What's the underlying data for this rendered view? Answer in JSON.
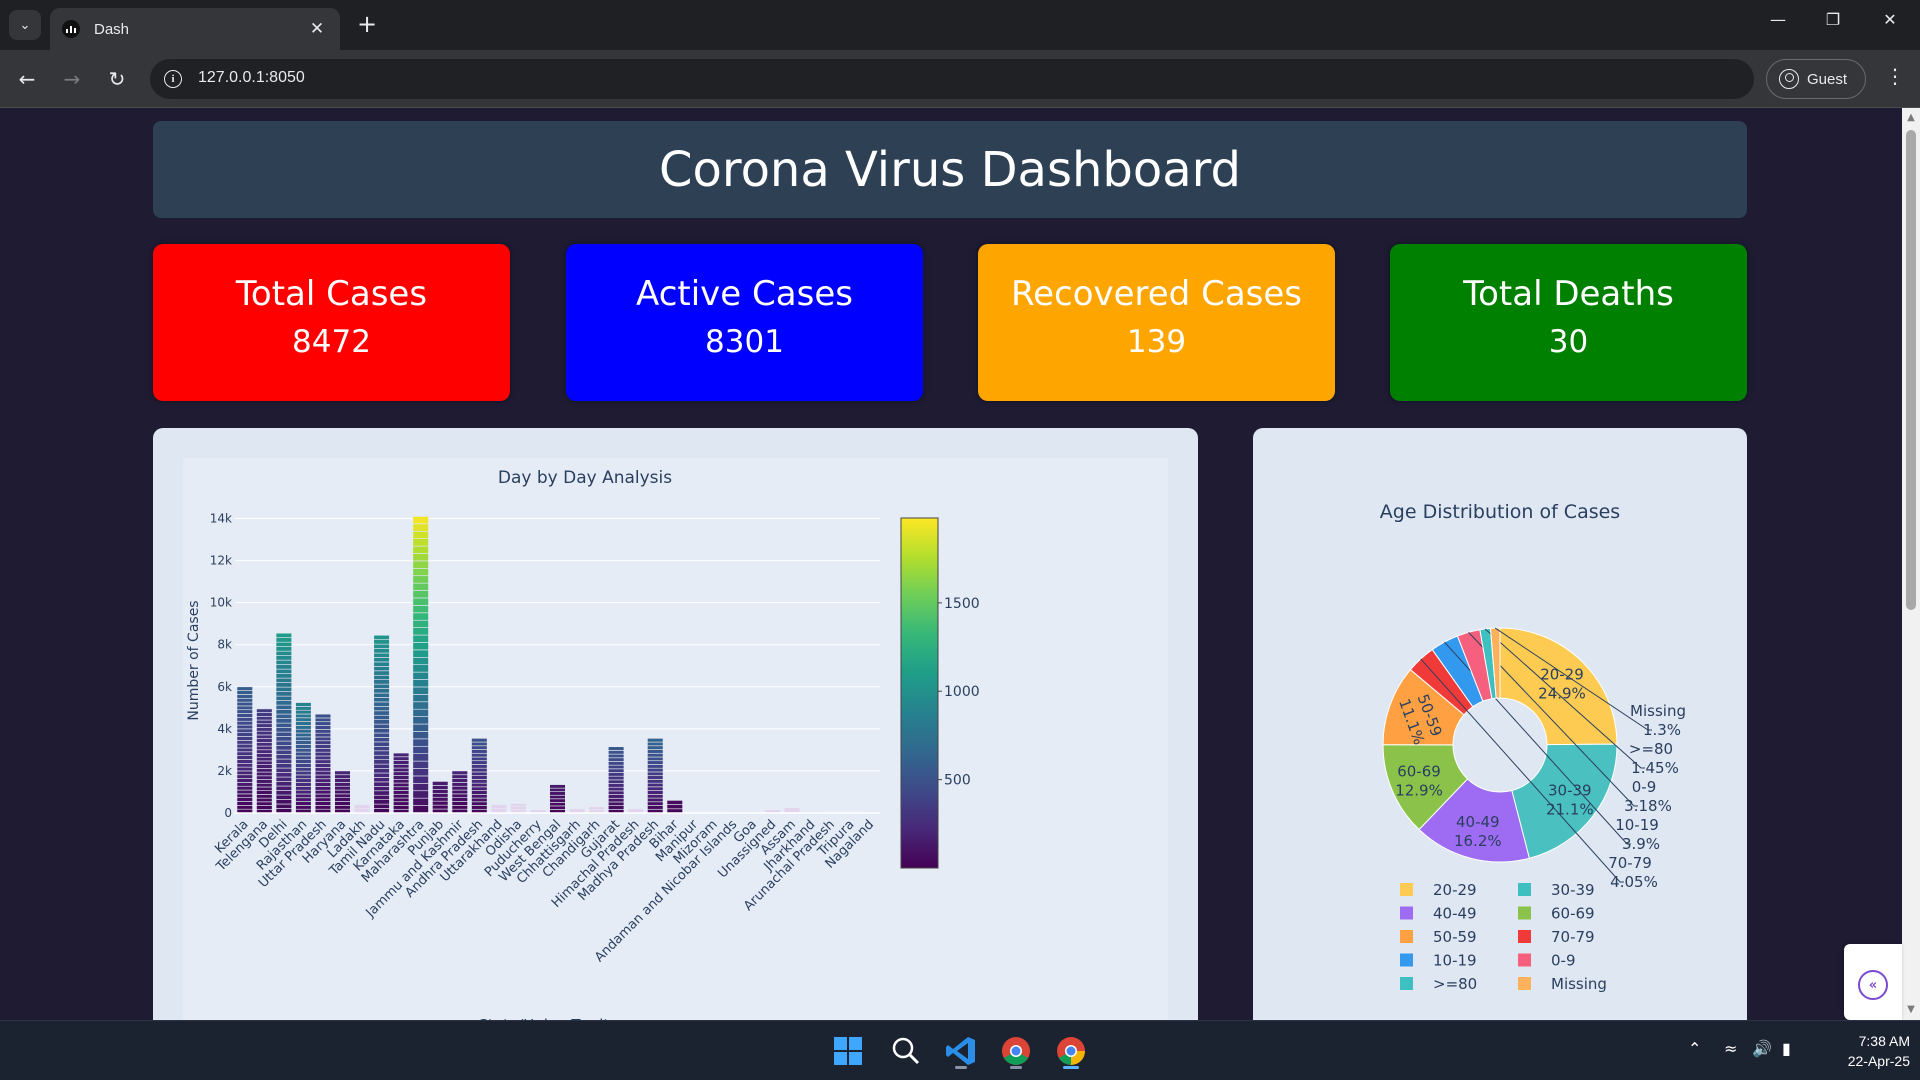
{
  "browser": {
    "tab_title": "Dash",
    "url": "127.0.0.1:8050",
    "profile_label": "Guest"
  },
  "dashboard": {
    "title": "Corona Virus Dashboard",
    "cards": [
      {
        "label": "Total Cases",
        "value": "8472",
        "color": "#ff0000"
      },
      {
        "label": "Active Cases",
        "value": "8301",
        "color": "#0000ff"
      },
      {
        "label": "Recovered Cases",
        "value": "139",
        "color": "#ffa500"
      },
      {
        "label": "Total Deaths",
        "value": "30",
        "color": "#008000"
      }
    ]
  },
  "chart_data": [
    {
      "type": "bar",
      "title": "Day by Day Analysis",
      "xlabel": "State/Union Territory",
      "ylabel": "Number of Cases",
      "ylim": [
        0,
        14500
      ],
      "yticks": [
        0,
        2000,
        4000,
        6000,
        8000,
        10000,
        12000,
        14000
      ],
      "ytick_labels": [
        "0",
        "2k",
        "4k",
        "6k",
        "8k",
        "10k",
        "12k",
        "14k"
      ],
      "colorscale": "Viridis",
      "colorbar": {
        "range": [
          0,
          1980
        ],
        "ticks": [
          500,
          1000,
          1500
        ],
        "tick_labels": [
          "500",
          "1000",
          "1500"
        ]
      },
      "categories": [
        "Kerala",
        "Telengana",
        "Delhi",
        "Rajasthan",
        "Uttar Pradesh",
        "Haryana",
        "Ladakh",
        "Tamil Nadu",
        "Karnataka",
        "Maharashtra",
        "Punjab",
        "Jammu and Kashmir",
        "Andhra Pradesh",
        "Uttarakhand",
        "Odisha",
        "Puducherry",
        "West Bengal",
        "Chhattisgarh",
        "Chandigarh",
        "Gujarat",
        "Himachal Pradesh",
        "Madhya Pradesh",
        "Bihar",
        "Manipur",
        "Mizoram",
        "Andaman and Nicobar Islands",
        "Goa",
        "Unassigned",
        "Assam",
        "Jharkhand",
        "Arunachal Pradesh",
        "Tripura",
        "Nagaland"
      ],
      "values": [
        6000,
        4950,
        8550,
        5250,
        4700,
        2000,
        400,
        8450,
        2850,
        14100,
        1500,
        2000,
        3550,
        400,
        450,
        150,
        1350,
        200,
        300,
        3150,
        200,
        3550,
        600,
        20,
        10,
        50,
        50,
        150,
        250,
        50,
        10,
        10,
        50
      ],
      "peak_colors": [
        600,
        350,
        1100,
        900,
        500,
        200,
        60,
        1050,
        200,
        1980,
        150,
        200,
        500,
        30,
        30,
        20,
        150,
        15,
        30,
        550,
        20,
        650,
        60,
        5,
        5,
        10,
        10,
        20,
        30,
        10,
        5,
        5,
        10
      ]
    },
    {
      "type": "pie",
      "title": "Age Distribution of Cases",
      "labels": [
        "20-29",
        "30-39",
        "40-49",
        "60-69",
        "50-59",
        "70-79",
        "10-19",
        "0-9",
        ">=80",
        "Missing"
      ],
      "values": [
        24.9,
        21.1,
        16.2,
        12.9,
        11.1,
        4.05,
        3.9,
        3.18,
        1.45,
        1.3
      ],
      "percent_labels": [
        "24.9%",
        "21.1%",
        "16.2%",
        "12.9%",
        "11.1%",
        "4.05%",
        "3.9%",
        "3.18%",
        "1.45%",
        "1.3%"
      ],
      "colors": [
        "#fecb52",
        "#4ac0c0",
        "#9e6cf3",
        "#8bc34a",
        "#ffa142",
        "#f03a3a",
        "#3399ee",
        "#f6607e",
        "#3ec0c0",
        "#feb15b"
      ],
      "legend": [
        {
          "label": "20-29",
          "color": "#fecb52"
        },
        {
          "label": "30-39",
          "color": "#3ec0c0"
        },
        {
          "label": "40-49",
          "color": "#9e6cf3"
        },
        {
          "label": "60-69",
          "color": "#8bc34a"
        },
        {
          "label": "50-59",
          "color": "#ffa142"
        },
        {
          "label": "70-79",
          "color": "#f03a3a"
        },
        {
          "label": "10-19",
          "color": "#3399ee"
        },
        {
          "label": "0-9",
          "color": "#f6607e"
        },
        {
          "label": ">=80",
          "color": "#3ec0c0"
        },
        {
          "label": "Missing",
          "color": "#feb15b"
        }
      ]
    }
  ],
  "taskbar": {
    "time": "7:38 AM",
    "date": "22-Apr-25"
  }
}
